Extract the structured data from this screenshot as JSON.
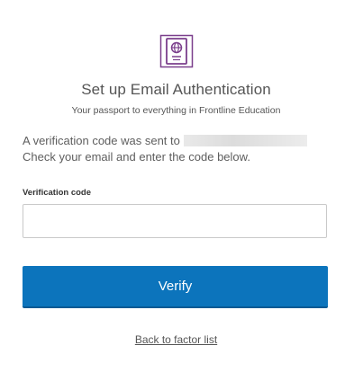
{
  "header": {
    "logo_icon": "passport-icon",
    "brand_color": "#7b3f8c",
    "title": "Set up Email Authentication",
    "subtitle": "Your passport to everything in Frontline Education"
  },
  "message": {
    "line1_prefix": "A verification code was sent to",
    "line2": "Check your email and enter the code below."
  },
  "form": {
    "code_label": "Verification code",
    "code_value": "",
    "code_placeholder": "",
    "verify_label": "Verify",
    "verify_color": "#0c74bc"
  },
  "footer": {
    "back_link_label": "Back to factor list"
  }
}
